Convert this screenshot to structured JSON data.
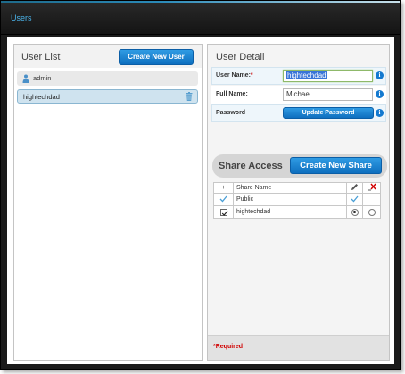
{
  "window": {
    "title": "Users"
  },
  "user_list": {
    "title": "User List",
    "create_label": "Create New User",
    "users": [
      {
        "name": "admin",
        "icon": "user-icon",
        "selected": false
      },
      {
        "name": "hightechdad",
        "icon": "trash-icon",
        "selected": true
      }
    ]
  },
  "user_detail": {
    "title": "User Detail",
    "username": {
      "label": "User Name:",
      "required_mark": "*",
      "value": "hightechdad"
    },
    "fullname": {
      "label": "Full Name:",
      "value": "Michael"
    },
    "password": {
      "label": "Password",
      "button_label": "Update Password"
    },
    "info_glyph": "i"
  },
  "share_access": {
    "title": "Share Access",
    "create_label": "Create New Share",
    "headers": {
      "add": "+",
      "name": "Share Name",
      "edit": "edit-icon",
      "delete": "delete-icon"
    },
    "rows": [
      {
        "name": "Public",
        "checked_style": "checkmark",
        "edit_style": "checkmark",
        "delete_style": "none"
      },
      {
        "name": "hightechdad",
        "checked_style": "checkbox",
        "edit_style": "radio-on",
        "delete_style": "radio-off"
      }
    ]
  },
  "footer": {
    "required_note": "*Required"
  },
  "colors": {
    "accent": "#1479cf",
    "title_text": "#4ab3ea",
    "required": "#d10000"
  }
}
